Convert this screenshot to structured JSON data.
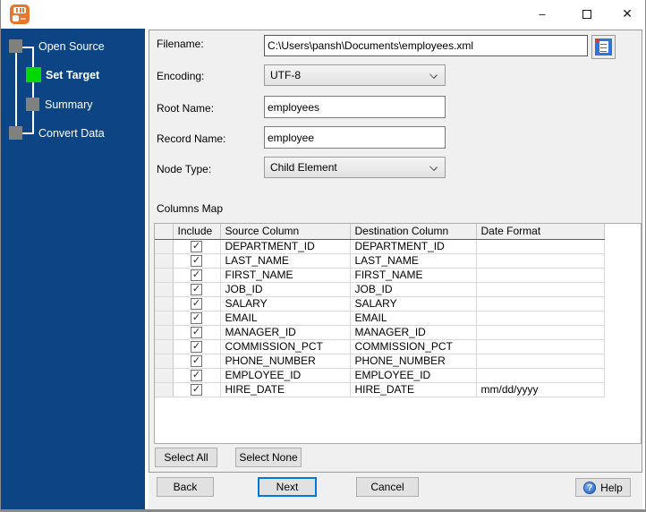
{
  "window": {
    "icons": {
      "minimize": "–",
      "close": "✕",
      "help": "?",
      "check": "✓"
    },
    "colors": {
      "sidebar_bg": "#0D4584",
      "active_step": "#00D800",
      "inactive_step": "#808080",
      "focus_border": "#0078D7",
      "app_icon": "#E8772E"
    }
  },
  "sidebar": {
    "steps": [
      {
        "label": "Open Source",
        "state": "inactive"
      },
      {
        "label": "Set Target",
        "state": "active"
      },
      {
        "label": "Summary",
        "state": "inactive"
      },
      {
        "label": "Convert Data",
        "state": "inactive"
      }
    ]
  },
  "form": {
    "filename": {
      "label": "Filename:",
      "value": "C:\\Users\\pansh\\Documents\\employees.xml"
    },
    "encoding": {
      "label": "Encoding:",
      "value": "UTF-8"
    },
    "root_name": {
      "label": "Root Name:",
      "value": "employees"
    },
    "record_name": {
      "label": "Record Name:",
      "value": "employee"
    },
    "node_type": {
      "label": "Node Type:",
      "value": "Child Element"
    }
  },
  "columns_map": {
    "title": "Columns Map",
    "headers": [
      "Include",
      "Source Column",
      "Destination Column",
      "Date Format"
    ],
    "rows": [
      {
        "include": true,
        "source": "DEPARTMENT_ID",
        "destination": "DEPARTMENT_ID",
        "date_format": ""
      },
      {
        "include": true,
        "source": "LAST_NAME",
        "destination": "LAST_NAME",
        "date_format": ""
      },
      {
        "include": true,
        "source": "FIRST_NAME",
        "destination": "FIRST_NAME",
        "date_format": ""
      },
      {
        "include": true,
        "source": "JOB_ID",
        "destination": "JOB_ID",
        "date_format": ""
      },
      {
        "include": true,
        "source": "SALARY",
        "destination": "SALARY",
        "date_format": ""
      },
      {
        "include": true,
        "source": "EMAIL",
        "destination": "EMAIL",
        "date_format": ""
      },
      {
        "include": true,
        "source": "MANAGER_ID",
        "destination": "MANAGER_ID",
        "date_format": ""
      },
      {
        "include": true,
        "source": "COMMISSION_PCT",
        "destination": "COMMISSION_PCT",
        "date_format": ""
      },
      {
        "include": true,
        "source": "PHONE_NUMBER",
        "destination": "PHONE_NUMBER",
        "date_format": ""
      },
      {
        "include": true,
        "source": "EMPLOYEE_ID",
        "destination": "EMPLOYEE_ID",
        "date_format": ""
      },
      {
        "include": true,
        "source": "HIRE_DATE",
        "destination": "HIRE_DATE",
        "date_format": "mm/dd/yyyy"
      }
    ]
  },
  "actions": {
    "select_all": "Select All",
    "select_none": "Select None",
    "back": "Back",
    "next": "Next",
    "cancel": "Cancel",
    "help": "Help"
  }
}
